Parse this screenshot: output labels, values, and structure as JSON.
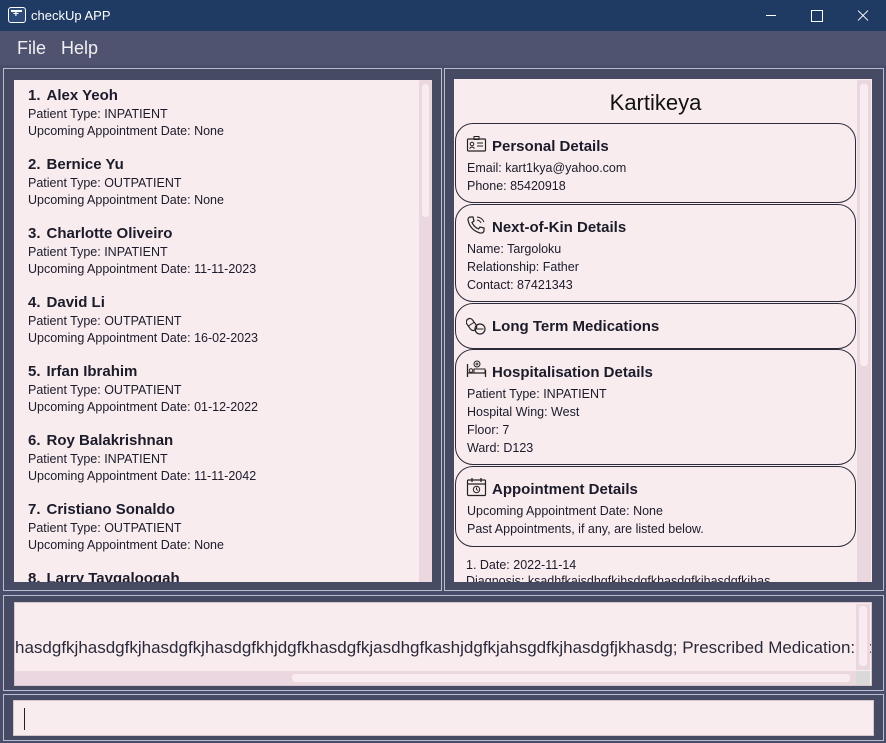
{
  "window": {
    "title": "checkUp APP"
  },
  "menu": {
    "file": "File",
    "help": "Help"
  },
  "patients": [
    {
      "index": "1.",
      "name": "Alex Yeoh",
      "type_line": "Patient Type: INPATIENT",
      "appt_line": "Upcoming Appointment Date: None"
    },
    {
      "index": "2.",
      "name": "Bernice Yu",
      "type_line": "Patient Type: OUTPATIENT",
      "appt_line": "Upcoming Appointment Date: None"
    },
    {
      "index": "3.",
      "name": "Charlotte Oliveiro",
      "type_line": "Patient Type: INPATIENT",
      "appt_line": "Upcoming Appointment Date: 11-11-2023"
    },
    {
      "index": "4.",
      "name": "David Li",
      "type_line": "Patient Type: OUTPATIENT",
      "appt_line": "Upcoming Appointment Date: 16-02-2023"
    },
    {
      "index": "5.",
      "name": "Irfan Ibrahim",
      "type_line": "Patient Type: OUTPATIENT",
      "appt_line": "Upcoming Appointment Date: 01-12-2022"
    },
    {
      "index": "6.",
      "name": "Roy Balakrishnan",
      "type_line": "Patient Type: INPATIENT",
      "appt_line": "Upcoming Appointment Date: 11-11-2042"
    },
    {
      "index": "7.",
      "name": "Cristiano Sonaldo",
      "type_line": "Patient Type: OUTPATIENT",
      "appt_line": "Upcoming Appointment Date: None"
    },
    {
      "index": "8.",
      "name": "Larry Tavgaloogah",
      "type_line": "",
      "appt_line": ""
    }
  ],
  "detail": {
    "name": "Kartikeya",
    "personal": {
      "title": "Personal Details",
      "icon": "id-card-icon",
      "email": "Email: kart1kya@yahoo.com",
      "phone": "Phone: 85420918"
    },
    "next_of_kin": {
      "title": "Next-of-Kin Details",
      "icon": "phone-icon",
      "name": "Name: Targoloku",
      "relationship": "Relationship: Father",
      "contact": "Contact: 87421343"
    },
    "medications": {
      "title": "Long Term Medications",
      "icon": "pills-icon"
    },
    "hospitalisation": {
      "title": "Hospitalisation Details",
      "icon": "hospital-bed-icon",
      "type": "Patient Type: INPATIENT",
      "wing": "Hospital Wing: West",
      "floor": "Floor: 7",
      "ward": "Ward: D123"
    },
    "appointment": {
      "title": "Appointment Details",
      "icon": "calendar-icon",
      "upcoming": "Upcoming Appointment Date: None",
      "past_note": "Past Appointments, if any, are listed below."
    },
    "past_appointments": [
      {
        "date": "1. Date: 2022-11-14",
        "diagnosis": "   Diagnosis: ksadhfkajsdhgfkjhsdgfkhasdgfkjhasdgfkjhas"
      }
    ]
  },
  "result": {
    "text": "hasdgfkjhasdgfkjhasdgfkjhasdgfkhjdgfkhasdgfkjasdhgfkashjdgfkjahsgdfkjhasdgfjkhasdg; Prescribed Medication: [ok]"
  },
  "command": {
    "value": "",
    "placeholder": ""
  },
  "colors": {
    "titlebar": "#1f3a63",
    "background": "#4a4d69",
    "panel": "#f9ecef"
  }
}
